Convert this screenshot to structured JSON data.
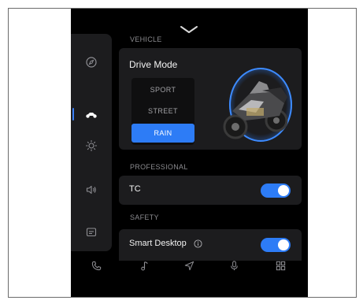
{
  "sections": {
    "vehicle": "VEHICLE",
    "professional": "PROFESSIONAL",
    "safety": "SAFETY"
  },
  "drive_mode": {
    "title": "Drive Mode",
    "options": [
      "SPORT",
      "STREET",
      "RAIN"
    ],
    "selected": "RAIN"
  },
  "professional": {
    "tc_label": "TC",
    "tc_enabled": true
  },
  "safety": {
    "smart_desktop_label": "Smart Desktop",
    "smart_desktop_enabled": true
  },
  "sidebar": {
    "items": [
      "compass-icon",
      "motorcycle-icon",
      "brightness-icon",
      "volume-icon",
      "message-icon"
    ],
    "active": "motorcycle-icon"
  },
  "dock": {
    "items": [
      "phone-icon",
      "music-icon",
      "navigation-icon",
      "microphone-icon",
      "apps-grid-icon"
    ]
  },
  "colors": {
    "accent": "#2d7cf6",
    "panel": "#1c1c1e",
    "background": "#000000"
  }
}
